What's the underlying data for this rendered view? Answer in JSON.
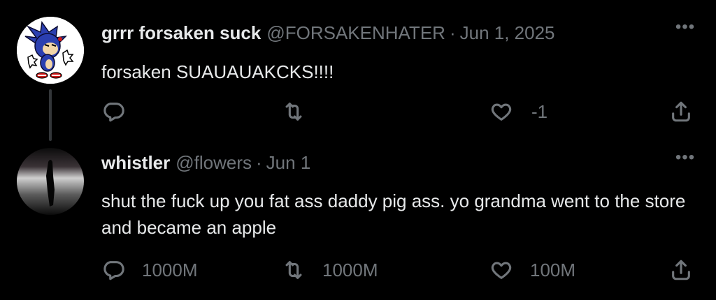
{
  "tweets": [
    {
      "name": "grrr forsaken suck",
      "handle": "@FORSAKENHATER",
      "separator": "·",
      "date": "Jun 1, 2025",
      "more": "•••",
      "text": "forsaken SUAUAUAKCKS!!!!",
      "reply_count": "",
      "retweet_count": "",
      "like_count": "-1"
    },
    {
      "name": "whistler",
      "handle": "@flowers",
      "separator": "·",
      "date": "Jun 1",
      "more": "•••",
      "text": "shut the fuck up you fat ass daddy pig ass. yo grandma went to the store and became an apple",
      "reply_count": "1000M",
      "retweet_count": "1000M",
      "like_count": "100M"
    }
  ],
  "icons": {
    "reply": "reply-icon",
    "retweet": "retweet-icon",
    "like": "like-icon",
    "share": "share-icon"
  },
  "colors": {
    "background": "#000000",
    "text": "#e7e9ea",
    "muted": "#71767b"
  }
}
